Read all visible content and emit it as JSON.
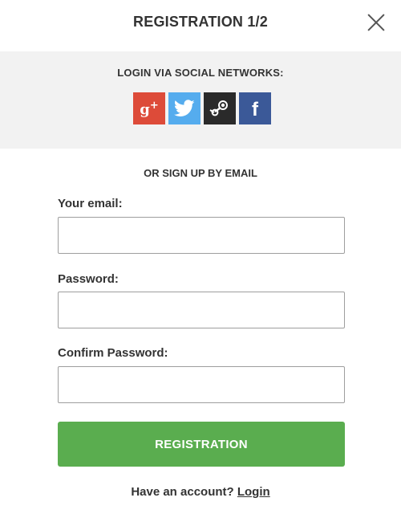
{
  "modal": {
    "title": "REGISTRATION 1/2",
    "close_icon": "close-icon"
  },
  "social": {
    "title": "LOGIN VIA SOCIAL NETWORKS:",
    "networks": [
      {
        "name": "google-plus",
        "icon": "google-plus-icon",
        "color": "#dd4b39"
      },
      {
        "name": "twitter",
        "icon": "twitter-icon",
        "color": "#55acee"
      },
      {
        "name": "steam",
        "icon": "steam-icon",
        "color": "#2a2a2a"
      },
      {
        "name": "facebook",
        "icon": "facebook-icon",
        "color": "#3b5998"
      }
    ]
  },
  "divider_text": "OR SIGN UP BY EMAIL",
  "form": {
    "email_label": "Your email:",
    "email_value": "",
    "password_label": "Password:",
    "password_value": "",
    "confirm_label": "Confirm Password:",
    "confirm_value": "",
    "submit_label": "REGISTRATION"
  },
  "footer": {
    "prompt": "Have an account?",
    "login_label": "Login"
  },
  "colors": {
    "accent": "#5aad4f",
    "panel_bg": "#f2f2f2"
  }
}
